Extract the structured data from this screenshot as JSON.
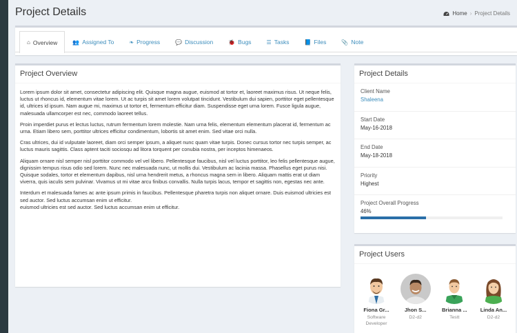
{
  "header": {
    "title": "Project Details"
  },
  "breadcrumb": {
    "home": "Home",
    "current": "Project Details"
  },
  "tabs": [
    {
      "label": "Overview",
      "icon": "home-icon",
      "active": true
    },
    {
      "label": "Assigned To",
      "icon": "users-icon"
    },
    {
      "label": "Progress",
      "icon": "leaf-icon"
    },
    {
      "label": "Discussion",
      "icon": "comments-icon"
    },
    {
      "label": "Bugs",
      "icon": "bug-icon"
    },
    {
      "label": "Tasks",
      "icon": "tasks-icon"
    },
    {
      "label": "Files",
      "icon": "book-icon"
    },
    {
      "label": "Note",
      "icon": "paperclip-icon"
    }
  ],
  "overview": {
    "title": "Project Overview",
    "paragraphs": [
      "Lorem ipsum dolor sit amet, consectetur adipiscing elit. Quisque magna augue, euismod at tortor et, laoreet maximus risus. Ut neque felis, luctus ut rhoncus id, elementum vitae lorem. Ut ac turpis sit amet lorem volutpat tincidunt. Vestibulum dui sapien, porttitor eget pellentesque id, ultrices id ipsum. Nam augue mi, maximus ut tortor et, fermentum efficitur diam. Suspendisse eget urna lorem. Fusce ligula augue, malesuada ullamcorper est nec, commodo laoreet tellus.",
      "Proin imperdiet purus et lectus luctus, rutrum fermentum lorem molestie. Nam urna felis, elementum elementum placerat id, fermentum ac urna. Etiam libero sem, porttitor ultrices efficitur condimentum, lobortis sit amet enim. Sed vitae orci nulla.",
      "Cras ultrices, dui id vulputate laoreet, diam orci semper ipsum, a aliquet nunc quam vitae turpis. Donec cursus tortor nec turpis semper, ac luctus mauris sagittis. Class aptent taciti sociosqu ad litora torquent per conubia nostra, per inceptos himenaeos.",
      "Aliquam ornare nisl semper nisl porttitor commodo vel vel libero. Pellentesque faucibus, nisl vel luctus porttitor, leo felis pellentesque augue, dignissim tempus risus odio sed lorem. Nunc nec malesuada nunc, ut mollis dui. Vestibulum ac lacinia massa. Phasellus eget purus nisi. Quisque sodales, tortor et elementum dapibus, nisl urna hendrerit metus, a rhoncus magna sem in libero. Aliquam mattis erat ut diam viverra, quis iaculis sem pulvinar. Vivamus ut mi vitae arcu finibus convallis. Nulla turpis lacus, tempor et sagittis non, egestas nec ante.",
      "Interdum et malesuada fames ac ante ipsum primis in faucibus. Pellentesque pharetra turpis non aliquet ornare. Duis euismod ultricies est sed auctor. Sed luctus accumsan enim ut efficitur.\neuismod ultricies est sed auctor. Sed luctus accumsan enim ut efficitur."
    ]
  },
  "details": {
    "title": "Project Details",
    "client_label": "Client Name",
    "client_value": "Shaleena",
    "start_label": "Start Date",
    "start_value": "May-16-2018",
    "end_label": "End Date",
    "end_value": "May-18-2018",
    "priority_label": "Priority",
    "priority_value": "Highest",
    "progress_label": "Project Overall Progress",
    "progress_value": "46%",
    "progress_fraction": 0.46
  },
  "users": {
    "title": "Project Users",
    "list": [
      {
        "name": "Fiona Gr...",
        "role": "Software Developer",
        "avatar": "man-avatar-icon"
      },
      {
        "name": "Jhon S...",
        "role": "D2-d2",
        "avatar": "photo-avatar-icon"
      },
      {
        "name": "Brianna ...",
        "role": "Testt",
        "avatar": "man-avatar-icon"
      },
      {
        "name": "Linda An...",
        "role": "D2-d2",
        "avatar": "woman-avatar-icon"
      }
    ]
  },
  "colors": {
    "accent": "#3c8dbc",
    "progress": "#2a6fa8",
    "sidebar": "#2c3b41"
  }
}
